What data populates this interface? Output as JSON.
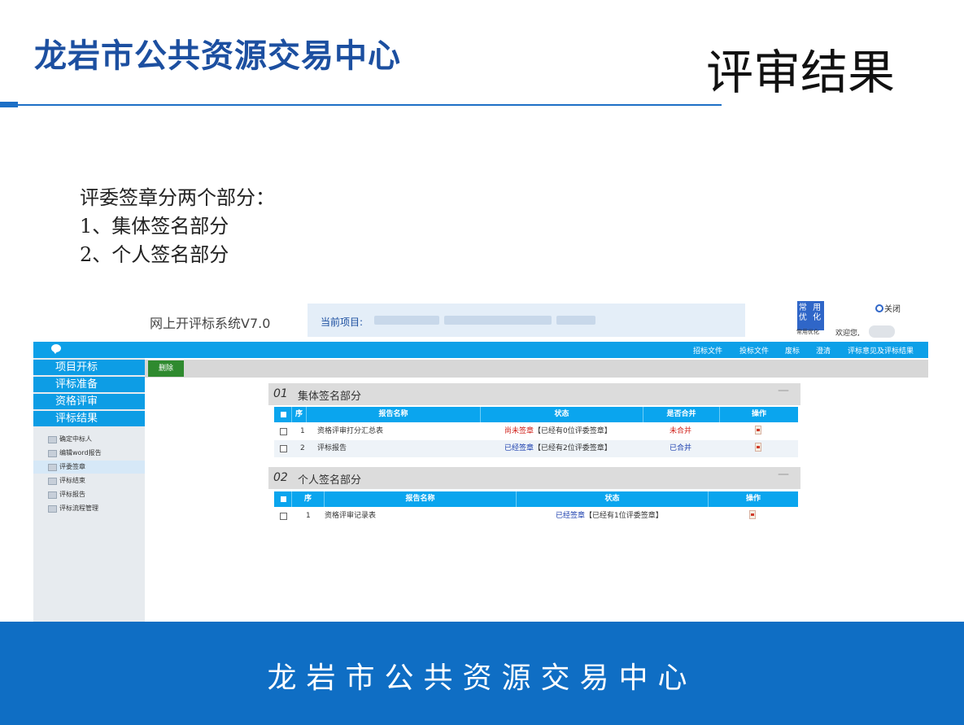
{
  "slide": {
    "title": "龙岩市公共资源交易中心",
    "topic": "评审结果",
    "intro": [
      "评委签章分两个部分：",
      "1、集体签名部分",
      "2、个人签名部分"
    ],
    "footer": "龙岩市公共资源交易中心",
    "colors": {
      "brand_blue": "#1c4fa0",
      "footer_blue": "#0f6ec4",
      "nav_blue": "#0da0e8"
    }
  },
  "app": {
    "name": "网上开评标系统V7.0",
    "project_label": "当前项目:",
    "favorites": {
      "line1": "常 用",
      "line2": "优 化",
      "caption": "常用优化"
    },
    "welcome": "欢迎您,",
    "close": "关闭",
    "top_nav": [
      "招标文件",
      "投标文件",
      "废标",
      "澄清",
      "评标意见及评标结果"
    ],
    "sidebar": {
      "categories": [
        "项目开标",
        "评标准备",
        "资格评审",
        "评标结果"
      ],
      "subitems": [
        "确定中标人",
        "编辑word报告",
        "评委签章",
        "评标结束",
        "评标报告",
        "评标流程管理"
      ],
      "active_subitem": "评委签章"
    },
    "toolbar": {
      "delete_label": "删除"
    },
    "group_section": {
      "num": "01",
      "title": "集体签名部分",
      "collapse": "—",
      "headers": {
        "seq": "序",
        "name": "报告名称",
        "status": "状态",
        "merged": "是否合并",
        "action": "操作"
      },
      "rows": [
        {
          "seq": "1",
          "name": "资格评审打分汇总表",
          "status_label": "尚未签章",
          "status_note": "【已经有0位评委签章】",
          "merged": "未合并"
        },
        {
          "seq": "2",
          "name": "评标报告",
          "status_label": "已经签章",
          "status_note": "【已经有2位评委签章】",
          "merged": "已合并"
        }
      ]
    },
    "personal_section": {
      "num": "02",
      "title": "个人签名部分",
      "collapse": "—",
      "headers": {
        "seq": "序",
        "name": "报告名称",
        "status": "状态",
        "action": "操作"
      },
      "rows": [
        {
          "seq": "1",
          "name": "资格评审记录表",
          "status_label": "已经签章",
          "status_note": "【已经有1位评委签章】"
        }
      ]
    }
  }
}
